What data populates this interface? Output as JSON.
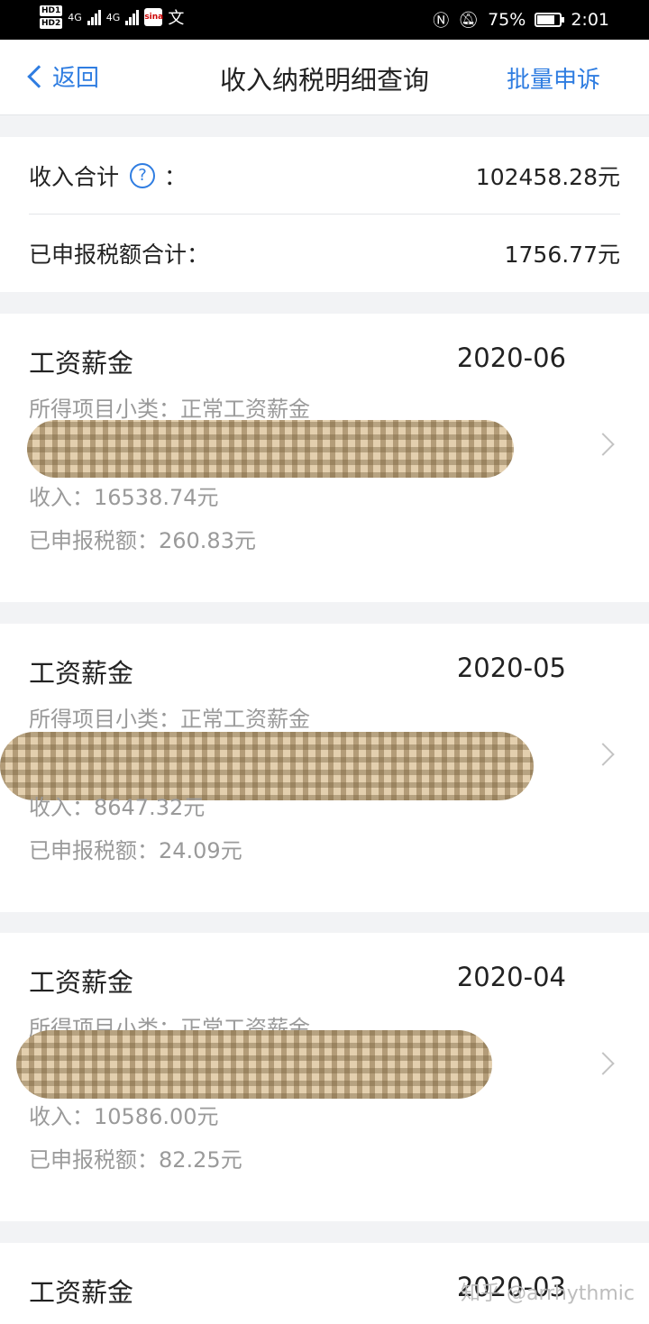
{
  "status_bar": {
    "hd1": "HD1",
    "hd2": "HD2",
    "net1": "4G",
    "net2": "4G",
    "app_icon_text": "sina",
    "wen": "文",
    "nfc_icon": "nfc-icon",
    "mute_icon": "bell-off-icon",
    "battery_percent": "75%",
    "time": "2:01"
  },
  "nav": {
    "back_label": "返回",
    "title": "收入纳税明细查询",
    "action_label": "批量申诉"
  },
  "summary": {
    "income_label": "收入合计",
    "help_icon": "?",
    "colon": "：",
    "income_value": "102458.28元",
    "tax_label": "已申报税额合计：",
    "tax_value": "1756.77元"
  },
  "records": [
    {
      "type": "工资薪金",
      "period": "2020-06",
      "subtype": "所得项目小类：正常工资薪金",
      "income": "收入：16538.74元",
      "tax": "已申报税额：260.83元"
    },
    {
      "type": "工资薪金",
      "period": "2020-05",
      "subtype": "所得项目小类：正常工资薪金",
      "income": "收入：8647.32元",
      "tax": "已申报税额：24.09元"
    },
    {
      "type": "工资薪金",
      "period": "2020-04",
      "subtype": "所得项目小类：正常工资薪金",
      "income": "收入：10586.00元",
      "tax": "已申报税额：82.25元"
    },
    {
      "type": "工资薪金",
      "period": "2020-03"
    }
  ],
  "watermark": "知乎 @arrhythmic"
}
